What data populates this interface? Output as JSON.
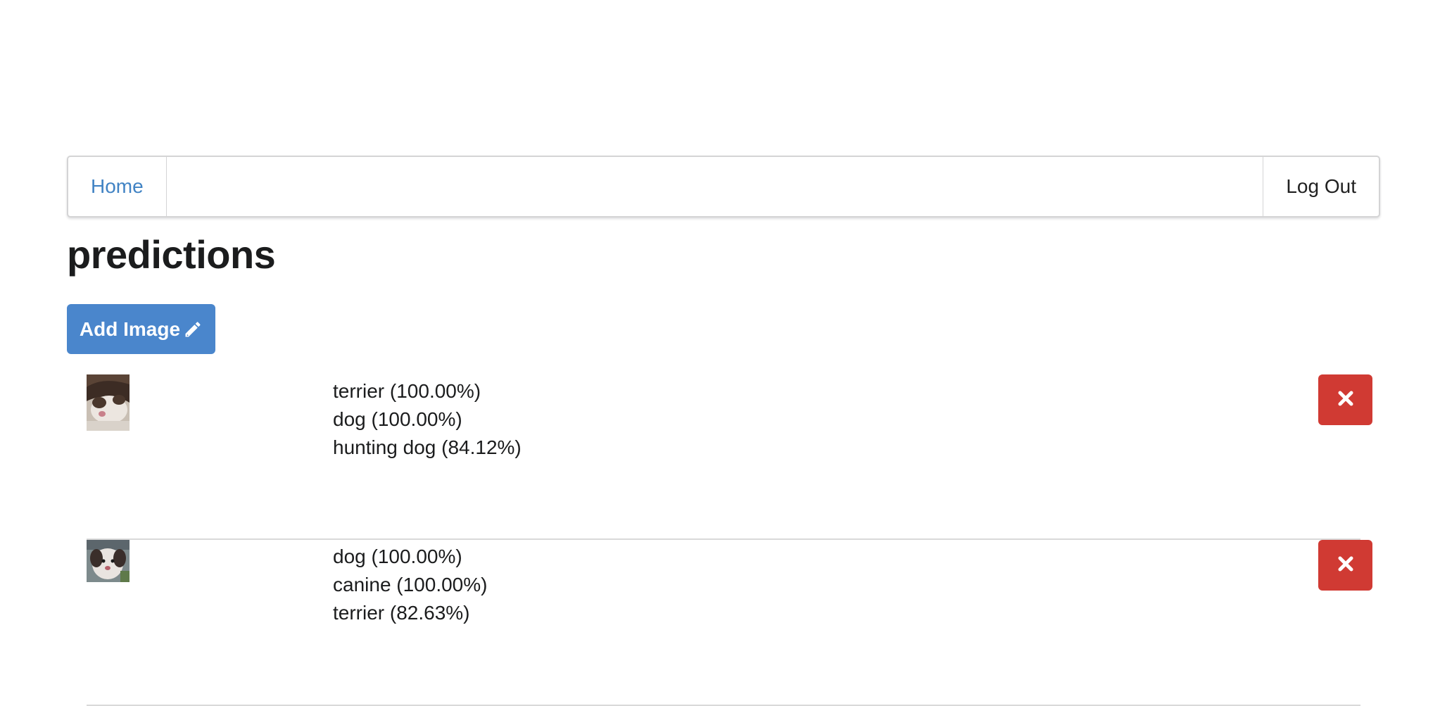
{
  "nav": {
    "home_label": "Home",
    "logout_label": "Log Out"
  },
  "page": {
    "title": "predictions"
  },
  "actions": {
    "add_image_label": "Add Image",
    "add_image_icon": "pencil-icon",
    "delete_icon": "close-icon"
  },
  "colors": {
    "primary": "#4a86cc",
    "danger": "#d03a33",
    "link": "#4183c4"
  },
  "predictions": [
    {
      "labels": [
        "terrier (100.00%)",
        "dog (100.00%)",
        "hunting dog (84.12%)"
      ]
    },
    {
      "labels": [
        "dog (100.00%)",
        "canine (100.00%)",
        "terrier (82.63%)"
      ]
    }
  ]
}
